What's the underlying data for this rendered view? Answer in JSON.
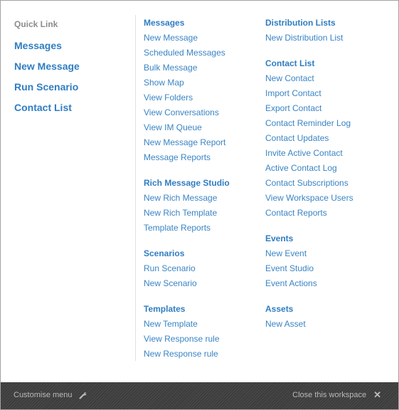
{
  "quick_link": {
    "title": "Quick Link",
    "items": [
      "Messages",
      "New Message",
      "Run Scenario",
      "Contact List"
    ]
  },
  "columns": [
    {
      "sections": [
        {
          "title": "Messages",
          "links": [
            "New Message",
            "Scheduled Messages",
            "Bulk Message",
            "Show Map",
            "View Folders",
            "View Conversations",
            "View IM Queue",
            "New Message Report",
            "Message Reports"
          ]
        },
        {
          "title": "Rich Message Studio",
          "links": [
            "New Rich Message",
            "New Rich Template",
            "Template Reports"
          ]
        },
        {
          "title": "Scenarios",
          "links": [
            "Run Scenario",
            "New Scenario"
          ]
        },
        {
          "title": "Templates",
          "links": [
            "New Template",
            "View Response rule",
            "New Response rule"
          ]
        }
      ]
    },
    {
      "sections": [
        {
          "title": "Distribution Lists",
          "links": [
            "New Distribution List"
          ]
        },
        {
          "title": "Contact List",
          "links": [
            "New Contact",
            "Import Contact",
            "Export Contact",
            "Contact Reminder Log",
            "Contact Updates",
            "Invite Active Contact",
            "Active Contact Log",
            "Contact Subscriptions",
            "View Workspace Users",
            "Contact Reports"
          ]
        },
        {
          "title": "Events",
          "links": [
            "New Event",
            "Event Studio",
            "Event Actions"
          ]
        },
        {
          "title": "Assets",
          "links": [
            "New Asset"
          ]
        }
      ]
    }
  ],
  "footer": {
    "customise_label": "Customise menu",
    "customise_icon": "wrench-icon",
    "close_label": "Close this workspace",
    "close_icon": "close-icon"
  },
  "colors": {
    "link": "#3a84c4",
    "heading": "#2f7dc1",
    "quick_title": "#8c8c8c",
    "footer_bg": "#424242",
    "footer_text": "#b9b9b9"
  }
}
